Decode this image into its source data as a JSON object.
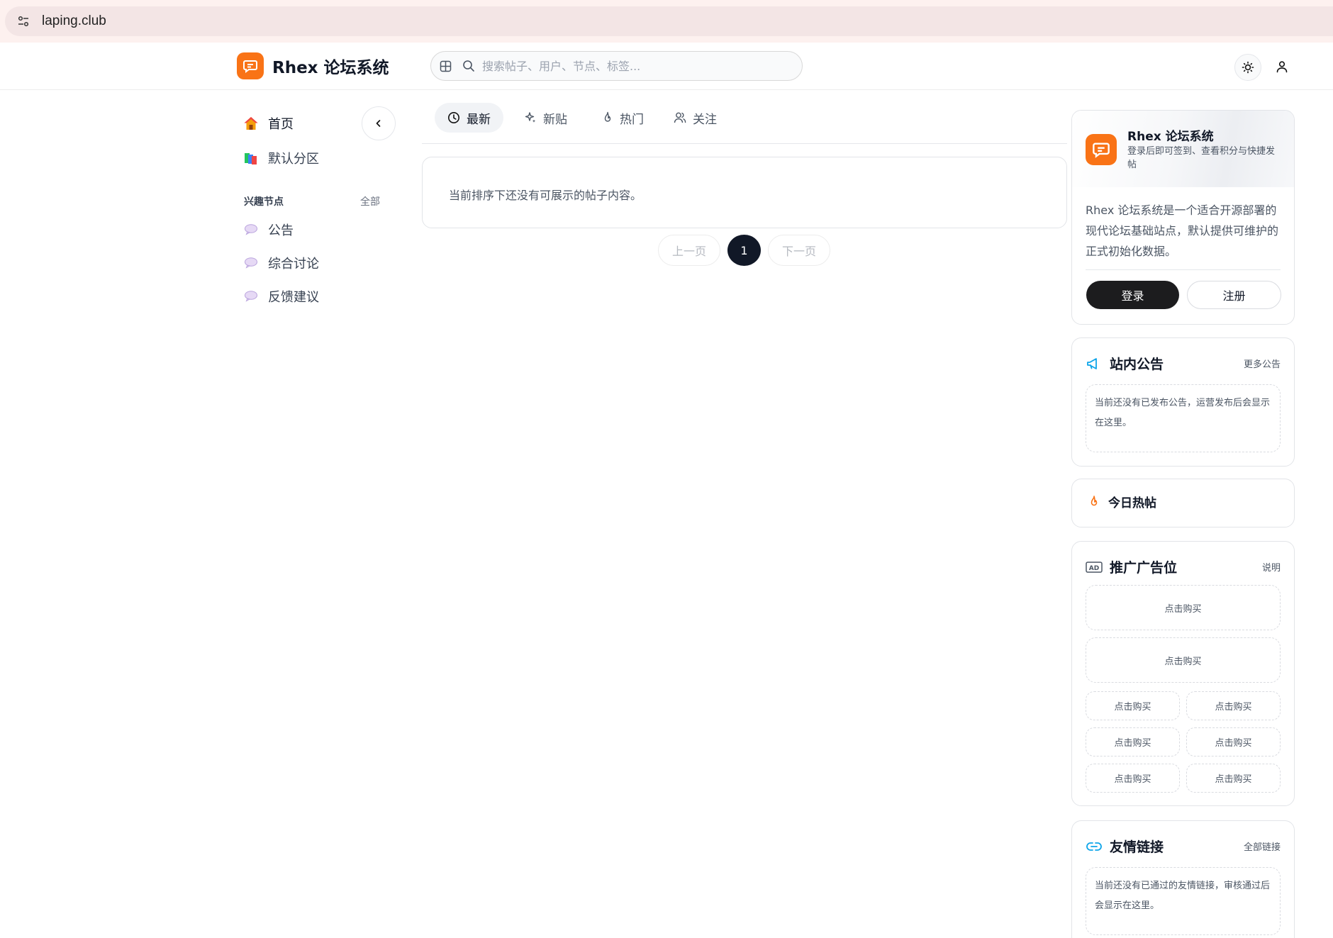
{
  "browser": {
    "url": "laping.club"
  },
  "header": {
    "brand": "Rhex 论坛系统",
    "search_placeholder": "搜索帖子、用户、节点、标签..."
  },
  "sidebar": {
    "items": [
      {
        "label": "首页",
        "icon": "house-icon"
      },
      {
        "label": "默认分区",
        "icon": "books-icon"
      }
    ],
    "section_title": "兴趣节点",
    "section_all": "全部",
    "nodes": [
      {
        "label": "公告",
        "icon": "speech-bubble-icon"
      },
      {
        "label": "综合讨论",
        "icon": "speech-bubble-icon"
      },
      {
        "label": "反馈建议",
        "icon": "speech-bubble-icon"
      }
    ]
  },
  "main": {
    "tabs": [
      {
        "label": "最新",
        "icon": "clock-icon",
        "active": true
      },
      {
        "label": "新贴",
        "icon": "sparkle-icon",
        "active": false
      },
      {
        "label": "热门",
        "icon": "flame-icon",
        "active": false
      },
      {
        "label": "关注",
        "icon": "users-icon",
        "active": false
      }
    ],
    "empty_message": "当前排序下还没有可展示的帖子内容。",
    "pagination": {
      "prev": "上一页",
      "current": "1",
      "next": "下一页"
    }
  },
  "right": {
    "intro": {
      "name": "Rhex 论坛系统",
      "subtitle": "登录后即可签到、查看积分与快捷发帖",
      "description": "Rhex 论坛系统是一个适合开源部署的现代论坛基础站点，默认提供可维护的正式初始化数据。",
      "login": "登录",
      "register": "注册"
    },
    "announcements": {
      "title": "站内公告",
      "link": "更多公告",
      "empty": "当前还没有已发布公告，运营发布后会显示在这里。"
    },
    "hot": {
      "title": "今日热帖"
    },
    "ads": {
      "title": "推广广告位",
      "link": "说明",
      "wide": [
        "点击购买",
        "点击购买"
      ],
      "small": [
        "点击购买",
        "点击购买",
        "点击购买",
        "点击购买",
        "点击购买",
        "点击购买"
      ]
    },
    "links": {
      "title": "友情链接",
      "link": "全部链接",
      "empty": "当前还没有已通过的友情链接，审核通过后会显示在这里。"
    }
  },
  "colors": {
    "brand": "#f97316",
    "dark": "#111827",
    "accent_blue": "#0ea5e9"
  }
}
